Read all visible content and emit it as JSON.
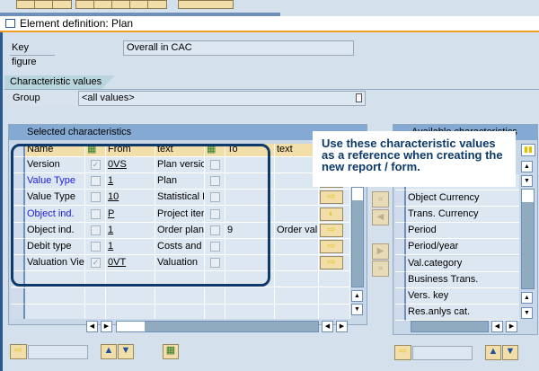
{
  "window": {
    "title": "Element definition: Plan"
  },
  "key_figure": {
    "label": "Key figure",
    "value": "Overall in CAC"
  },
  "tab": {
    "label": "Characteristic values"
  },
  "group": {
    "label": "Group",
    "value": "<all values>"
  },
  "selected": {
    "title": "Selected characteristics",
    "columns": [
      "Name",
      "From",
      "text",
      "To",
      "text"
    ],
    "rows": [
      {
        "name": "Version",
        "checked": true,
        "from": "0VS",
        "text": "Plan versio",
        "to": "",
        "text2": "",
        "link": false
      },
      {
        "name": "Value Type",
        "checked": false,
        "from": "1",
        "text": "Plan",
        "to": "",
        "text2": "",
        "link": true
      },
      {
        "name": "Value Type",
        "checked": false,
        "from": "10",
        "text": "Statistical P",
        "to": "",
        "text2": "",
        "link": false
      },
      {
        "name": "Object ind.",
        "checked": false,
        "from": "P",
        "text": "Project iten",
        "to": "",
        "text2": "",
        "link": true
      },
      {
        "name": "Object ind.",
        "checked": false,
        "from": "1",
        "text": "Order plan",
        "to": "9",
        "text2": "Order valu",
        "link": false
      },
      {
        "name": "Debit type",
        "checked": false,
        "from": "1",
        "text": "Costs and",
        "to": "",
        "text2": "",
        "link": false
      },
      {
        "name": "Valuation View",
        "checked": true,
        "from": "0VT",
        "text": "Valuation",
        "to": "",
        "text2": "",
        "link": false
      }
    ]
  },
  "available": {
    "title": "Available characteristics",
    "items": [
      "Object Currency",
      "Trans. Currency",
      "Period",
      "Period/year",
      "Val.category",
      "Business Trans.",
      "Vers. key",
      "Res.anlys cat."
    ]
  },
  "callout": {
    "text": "Use these characteristic values as a reference when creating the new report / form."
  },
  "colors": {
    "callout_border": "#0d3a6b",
    "header": "#84aad4",
    "accent": "#f0a020"
  }
}
